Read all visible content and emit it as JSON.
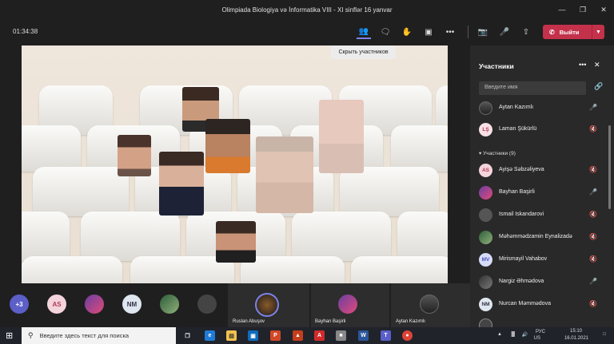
{
  "window": {
    "title": "Olimpiada Biologiya və İnformatika VIII - XI sinflər 16 yanvar"
  },
  "toolbar": {
    "timer": "01:34:38",
    "leave_label": "Выйти",
    "tooltip": "Скрыть участников"
  },
  "panel": {
    "title": "Участники",
    "search_placeholder": "Введите имя",
    "section_label": "Участники (9)",
    "top_people": [
      {
        "initials": "",
        "name": "Aytan Kazımlı",
        "mic": "on"
      },
      {
        "initials": "LŞ",
        "name": "Laman Şükürlü",
        "mic": "muted"
      }
    ],
    "people": [
      {
        "initials": "AS",
        "name": "Ayişə Səbzəliyeva",
        "mic": "muted"
      },
      {
        "initials": "",
        "name": "Bayhan Başirli",
        "mic": "on"
      },
      {
        "initials": "",
        "name": "Ismail Iskandarovi",
        "mic": "muted"
      },
      {
        "initials": "",
        "name": "Məhəmmədzamin Eynalizadə",
        "mic": "muted"
      },
      {
        "initials": "MV",
        "name": "Mirismayil Vahabov",
        "mic": "muted"
      },
      {
        "initials": "",
        "name": "Nargiz Əhmədova",
        "mic": "on"
      },
      {
        "initials": "NM",
        "name": "Nurcan Məmmədova",
        "mic": "muted"
      }
    ]
  },
  "strip": {
    "more_count": "+3",
    "chips": [
      "AS",
      "NM"
    ],
    "tiles": [
      "Ruslan Abuşov",
      "Bayhan Başirli",
      "Aytan Kazımlı"
    ]
  },
  "taskbar": {
    "search_placeholder": "Введите здесь текст для поиска",
    "lang_top": "РУС",
    "lang_bottom": "US",
    "time": "15:10",
    "date": "16.01.2021"
  },
  "colors": {
    "leave": "#c4314b",
    "accent": "#7b83eb",
    "avatar_ls": "#f7e0e6",
    "avatar_as": "#f4d4dc",
    "avatar_mv": "#d6dcf7",
    "avatar_nm": "#dfe6ef"
  }
}
